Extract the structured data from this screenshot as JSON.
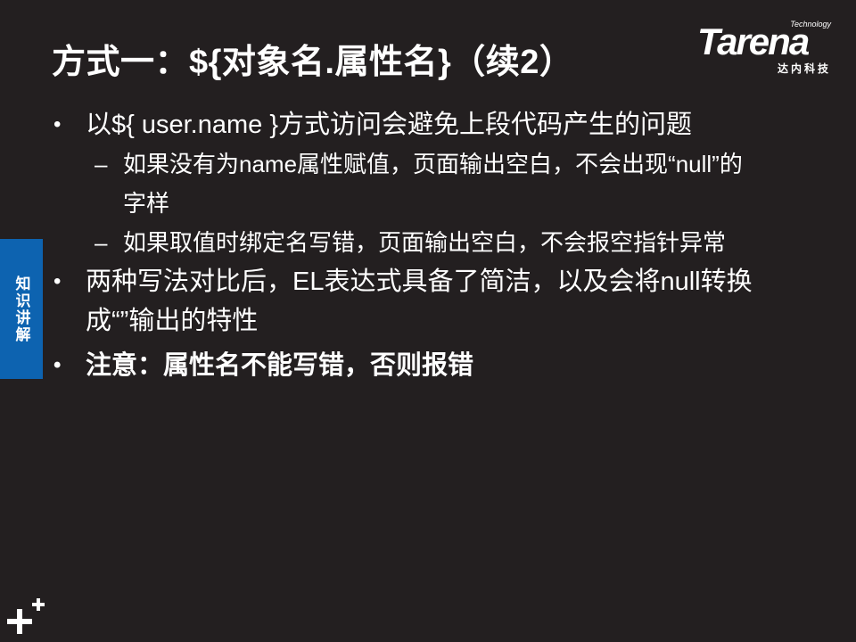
{
  "slide": {
    "title": "方式一：${对象名.属性名}（续2）",
    "side_tab": "知识讲解"
  },
  "logo": {
    "small": "Technology",
    "main": "Tarena",
    "sub": "达内科技"
  },
  "bullets": [
    {
      "mark": "•",
      "text": "以${ user.name }方式访问会避免上段代码产生的问题",
      "subs": [
        {
          "mark": "–",
          "text": "如果没有为name属性赋值，页面输出空白，不会出现“null”的字样"
        },
        {
          "mark": "–",
          "text": "如果取值时绑定名写错，页面输出空白，不会报空指针异常"
        }
      ]
    },
    {
      "mark": "•",
      "text": "两种写法对比后，EL表达式具备了简洁，以及会将null转换成“”输出的特性",
      "subs": []
    },
    {
      "mark": "•",
      "text": "注意：属性名不能写错，否则报错",
      "subs": []
    }
  ],
  "colors": {
    "background": "#231f20",
    "text": "#ffffff",
    "side_tab": "#0d63b0"
  },
  "icons": {
    "corner": "plus-plus-icon"
  }
}
